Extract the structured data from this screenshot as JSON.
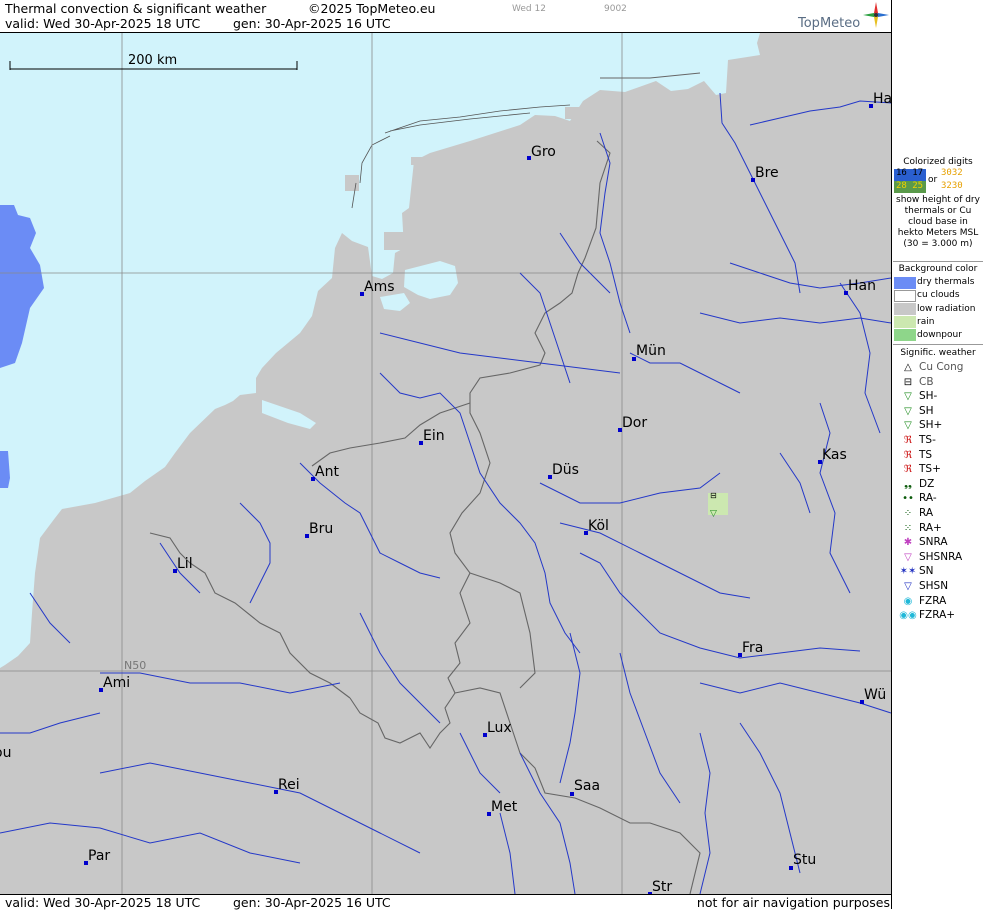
{
  "header": {
    "title": "Thermal convection & significant weather",
    "copyright": "©2025 TopMeteo.eu",
    "code_day": "Wed 12",
    "code_num": "9002",
    "valid": "valid:  Wed  30-Apr-2025  18 UTC",
    "generated": "gen: 30-Apr-2025 16 UTC",
    "brand": "TopMeteo"
  },
  "footer": {
    "valid": "valid:  Wed  30-Apr-2025  18 UTC",
    "generated": "gen: 30-Apr-2025 16 UTC",
    "note": "not for air navigation purposes"
  },
  "map": {
    "scale_label": "200 km",
    "gridline_label": "N50",
    "cities": {
      "ha": "Ha",
      "gro": "Gro",
      "bre": "Bre",
      "ams": "Ams",
      "han": "Han",
      "mun": "Mün",
      "dor": "Dor",
      "ein": "Ein",
      "kas": "Kas",
      "ant": "Ant",
      "dus": "Düs",
      "bru": "Bru",
      "kol": "Köl",
      "lil": "Lil",
      "fra": "Fra",
      "ami": "Ami",
      "wu": "Wü",
      "lux": "Lux",
      "ou": "ou",
      "rei": "Rei",
      "saa": "Saa",
      "met": "Met",
      "stu": "Stu",
      "par": "Par",
      "str": "Str"
    },
    "colors": {
      "sea": "#d1f3fb",
      "land": "#c8c8c8",
      "dry_thermals": "#6b8cf5",
      "rain": "#cce8b0",
      "rivers": "#2438c8",
      "borders": "#666666",
      "grid": "#8a8a8a",
      "city_marker": "#0000cc"
    }
  },
  "legend": {
    "digits_title": "Colorized digits",
    "digits_sample_a_top": "16 17",
    "digits_sample_a_bottom": "28 25",
    "digits_or": "or",
    "digits_sample_b_top": "3032",
    "digits_sample_b_bottom": "3230",
    "digits_note": "show height of dry thermals or Cu cloud base in hekto Meters MSL (30 = 3.000 m)",
    "background_title": "Background color",
    "background": [
      {
        "label": "dry thermals",
        "color": "#6b8cf5"
      },
      {
        "label": "cu clouds",
        "color": "#ffffff"
      },
      {
        "label": "low radiation",
        "color": "#c8c8c8"
      },
      {
        "label": "rain",
        "color": "#cce8b0"
      },
      {
        "label": "downpour",
        "color": "#8ed68a"
      }
    ],
    "weather_title": "Signific. weather",
    "weather": [
      {
        "label": "Cu Cong",
        "icon": "cu-cong-icon",
        "glyph": "△",
        "color": "#000000",
        "label_color": "#555555"
      },
      {
        "label": "CB",
        "icon": "cb-icon",
        "glyph": "⊟",
        "color": "#000000",
        "label_color": "#555555"
      },
      {
        "label": "SH-",
        "icon": "shower-light-icon",
        "glyph": "▽",
        "color": "#1a8a1a",
        "label_color": "#000000"
      },
      {
        "label": "SH",
        "icon": "shower-icon",
        "glyph": "▽",
        "color": "#1a8a1a",
        "label_color": "#000000"
      },
      {
        "label": "SH+",
        "icon": "shower-heavy-icon",
        "glyph": "▽",
        "color": "#1a8a1a",
        "label_color": "#000000"
      },
      {
        "label": "TS-",
        "icon": "thunderstorm-light-icon",
        "glyph": "ℜ",
        "color": "#cc1111",
        "label_color": "#000000"
      },
      {
        "label": "TS",
        "icon": "thunderstorm-icon",
        "glyph": "ℜ",
        "color": "#cc1111",
        "label_color": "#000000"
      },
      {
        "label": "TS+",
        "icon": "thunderstorm-heavy-icon",
        "glyph": "ℜ",
        "color": "#cc1111",
        "label_color": "#000000"
      },
      {
        "label": "DZ",
        "icon": "drizzle-icon",
        "glyph": "❟❟",
        "color": "#0a5a0a",
        "label_color": "#000000"
      },
      {
        "label": "RA-",
        "icon": "rain-light-icon",
        "glyph": "••",
        "color": "#0a5a0a",
        "label_color": "#000000"
      },
      {
        "label": "RA",
        "icon": "rain-icon",
        "glyph": "⁘",
        "color": "#0a5a0a",
        "label_color": "#000000"
      },
      {
        "label": "RA+",
        "icon": "rain-heavy-icon",
        "glyph": "⁙",
        "color": "#0a5a0a",
        "label_color": "#000000"
      },
      {
        "label": "SNRA",
        "icon": "snow-rain-icon",
        "glyph": "✱",
        "color": "#c040c0",
        "label_color": "#000000"
      },
      {
        "label": "SHSNRA",
        "icon": "snow-rain-shower-icon",
        "glyph": "▽",
        "color": "#c040c0",
        "label_color": "#000000"
      },
      {
        "label": "SN",
        "icon": "snow-icon",
        "glyph": "✶✶",
        "color": "#2030c0",
        "label_color": "#000000"
      },
      {
        "label": "SHSN",
        "icon": "snow-shower-icon",
        "glyph": "▽",
        "color": "#2030c0",
        "label_color": "#000000"
      },
      {
        "label": "FZRA",
        "icon": "freezing-rain-icon",
        "glyph": "◉",
        "color": "#20b8d8",
        "label_color": "#000000"
      },
      {
        "label": "FZRA+",
        "icon": "freezing-rain-heavy-icon",
        "glyph": "◉◉",
        "color": "#20b8d8",
        "label_color": "#000000"
      }
    ]
  }
}
